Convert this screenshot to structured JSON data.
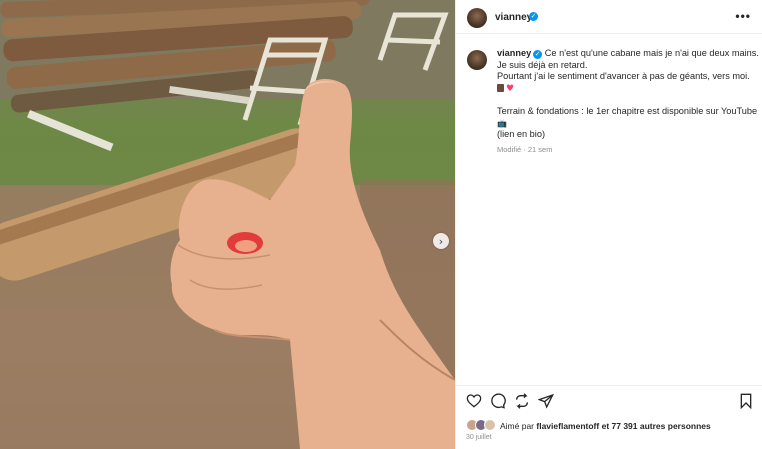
{
  "post": {
    "username": "vianney",
    "verified_icon": "verified-badge-icon",
    "more_icon": "more-options-icon"
  },
  "caption": {
    "username": "vianney",
    "line1": "Ce n'est qu'une cabane mais je n'ai que deux mains. Je suis déjà en retard.",
    "line2": "Pourtant j'ai le sentiment d'avancer à pas de géants, vers moi.",
    "line4": "Terrain & fondations : le 1er chapitre est disponible sur YouTube",
    "line5": "(lien en bio)",
    "edited": "Modifié · 21 sem"
  },
  "actions": {
    "like_icon": "heart-icon",
    "comment_icon": "comment-icon",
    "share_icon": "share-icon",
    "send_icon": "send-icon",
    "save_icon": "bookmark-icon"
  },
  "likes": {
    "prefix": "Aimé par",
    "user": "flavieflamentoff",
    "suffix": "et 77 391 autres personnes"
  },
  "date": "30 juillet",
  "colors": {
    "verified": "#0095f6",
    "text": "#262626",
    "muted": "#8e8e8e",
    "heart": "#ff3b6b"
  }
}
